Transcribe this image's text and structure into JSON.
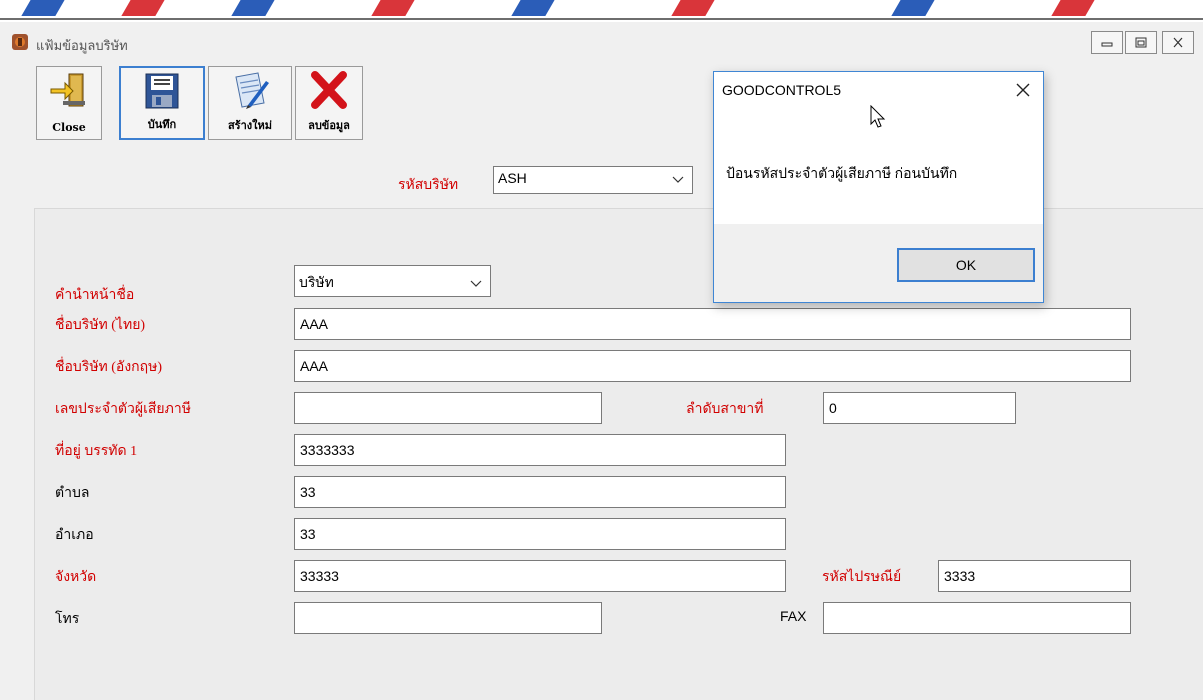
{
  "window": {
    "title": "แฟ้มข้อมูลบริษัท"
  },
  "toolbar": {
    "close_label": "Close",
    "save_label": "บันทึก",
    "new_label": "สร้างใหม่",
    "delete_label": "ลบข้อมูล"
  },
  "company": {
    "label": "รหัสบริษัท",
    "value": "ASH"
  },
  "form": {
    "prefix_label": "คำนำหน้าชื่อ",
    "prefix_value": "บริษัท",
    "name_th_label": "ชื่อบริษัท (ไทย)",
    "name_th_value": "AAA",
    "name_en_label": "ชื่อบริษัท (อังกฤษ)",
    "name_en_value": "AAA",
    "tax_id_label": "เลขประจำตัวผู้เสียภาษี",
    "tax_id_value": "",
    "branch_label": "ลำดับสาขาที่",
    "branch_value": "0",
    "address_label": "ที่อยู่ บรรทัด 1",
    "address_value": "3333333",
    "subdistrict_label": "ตำบล",
    "subdistrict_value": "33",
    "district_label": "อำเภอ",
    "district_value": "33",
    "province_label": "จังหวัด",
    "province_value": "33333",
    "postcode_label": "รหัสไปรษณีย์",
    "postcode_value": "3333",
    "phone_label": "โทร",
    "phone_value": "",
    "fax_label": "FAX",
    "fax_value": ""
  },
  "dialog": {
    "title": "GOODCONTROL5",
    "message": "ป้อนรหัสประจำตัวผู้เสียภาษี ก่อนบันทึก",
    "ok_label": "OK"
  },
  "colors": {
    "required_label": "#d10000",
    "accent": "#3c7fd0"
  },
  "icons": [
    "app-icon",
    "minimize-icon",
    "maximize-icon",
    "close-window-icon",
    "exit-door-icon",
    "floppy-disk-icon",
    "new-document-icon",
    "delete-x-icon",
    "dropdown-arrow-icon",
    "dialog-close-icon",
    "mouse-cursor-icon"
  ]
}
